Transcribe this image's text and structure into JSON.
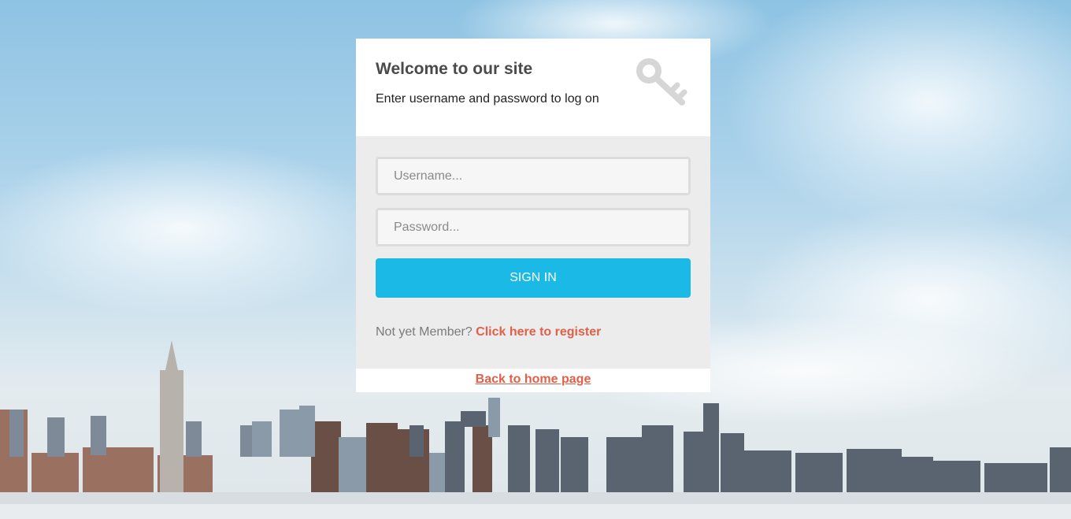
{
  "login": {
    "title": "Welcome to our site",
    "subtitle": "Enter username and password to log on",
    "icon": "key-icon",
    "username_placeholder": "Username...",
    "password_placeholder": "Password...",
    "signin_label": "SIGN IN",
    "register_prompt": "Not yet Member?",
    "register_link": "Click here to register",
    "home_link": "Back to home page"
  },
  "colors": {
    "accent": "#1ab9e6",
    "link": "#e0604a",
    "panel": "#ececec"
  }
}
